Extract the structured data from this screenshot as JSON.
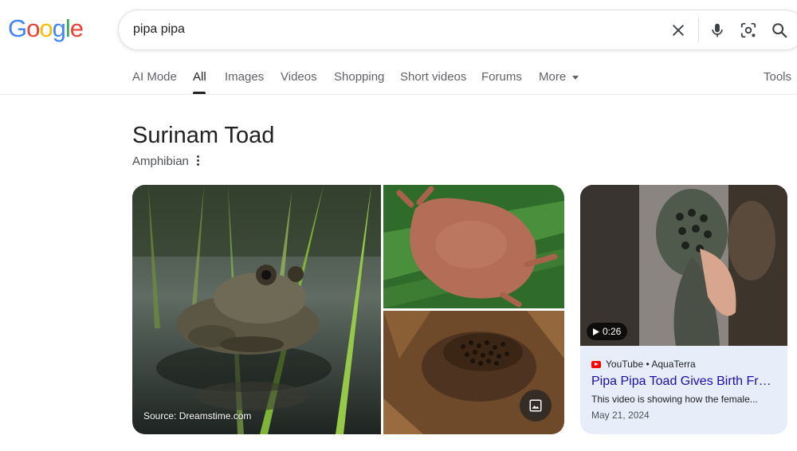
{
  "logo": {
    "letters": [
      "G",
      "o",
      "o",
      "g",
      "l",
      "e"
    ],
    "colors": [
      "#4285F4",
      "#EA4335",
      "#FBBC05",
      "#4285F4",
      "#34A853",
      "#EA4335"
    ]
  },
  "search": {
    "query": "pipa pipa",
    "placeholder": ""
  },
  "tabs": [
    {
      "label": "AI Mode"
    },
    {
      "label": "All",
      "active": true
    },
    {
      "label": "Images"
    },
    {
      "label": "Videos"
    },
    {
      "label": "Shopping"
    },
    {
      "label": "Short videos"
    },
    {
      "label": "Forums"
    },
    {
      "label": "More"
    }
  ],
  "tools_label": "Tools",
  "entity": {
    "title": "Surinam Toad",
    "subtitle": "Amphibian"
  },
  "gallery": {
    "source_label": "Source: Dreamstime.com"
  },
  "video": {
    "duration": "0:26",
    "source": "YouTube • AquaTerra",
    "title": "Pipa Pipa Toad Gives Birth From...",
    "description": "This video is showing how the female...",
    "date": "May 21, 2024"
  },
  "icons": [
    "clear-icon",
    "microphone-icon",
    "lens-icon",
    "search-icon",
    "kebab-menu-icon",
    "images-icon",
    "play-icon",
    "youtube-icon"
  ]
}
